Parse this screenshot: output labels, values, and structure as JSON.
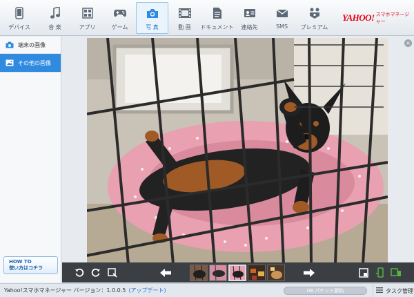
{
  "nav": {
    "items": [
      {
        "label": "デバイス",
        "icon": "phone-icon"
      },
      {
        "label": "音 楽",
        "icon": "music-note-icon"
      },
      {
        "label": "アプリ",
        "icon": "apps-grid-icon"
      },
      {
        "label": "ゲーム",
        "icon": "gamepad-icon"
      },
      {
        "label": "写 真",
        "icon": "camera-icon"
      },
      {
        "label": "動 画",
        "icon": "film-icon"
      },
      {
        "label": "ドキュメント",
        "icon": "document-icon"
      },
      {
        "label": "連絡先",
        "icon": "contact-card-icon"
      },
      {
        "label": "SMS",
        "icon": "envelope-icon"
      },
      {
        "label": "プレミアム",
        "icon": "premium-icon"
      }
    ],
    "active_index": 4,
    "brand_logo": "YAHOO!",
    "brand_sub": "スマホマネージャー",
    "brand_color": "#e60012",
    "accent_color": "#2f8ae0"
  },
  "sidebar": {
    "items": [
      {
        "label": "端末の画像",
        "icon": "camera-icon"
      },
      {
        "label": "その他の画像",
        "icon": "image-icon"
      }
    ],
    "active_index": 1,
    "howto_line1": "HOW TO",
    "howto_line2": "使い方はコチラ"
  },
  "viewer": {
    "close_glyph": "×",
    "photo_description_icon": "dog-in-cage-photo",
    "thumbnail_count": 5,
    "selected_thumbnail": 2
  },
  "status": {
    "version_text": "Yahoo!スマホマネージャー バージョン：1.0.0.5",
    "update_text": "(アップデート)",
    "progress_text": "0B パケット節約",
    "task_text": "タスク管理"
  }
}
